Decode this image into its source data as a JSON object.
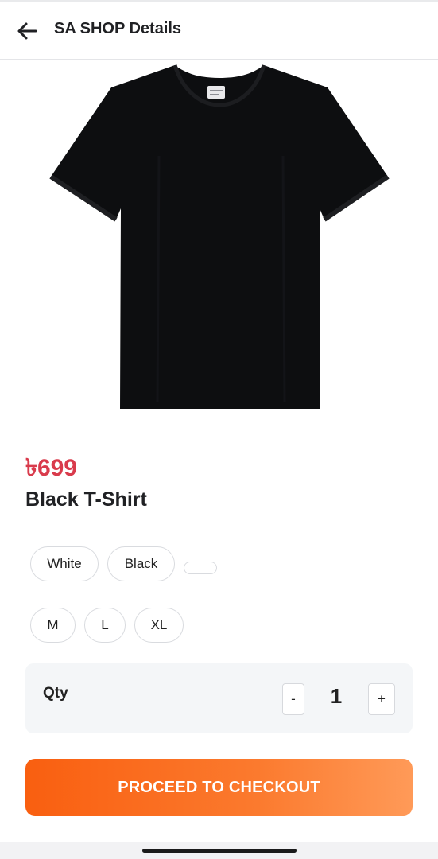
{
  "header": {
    "title": "SA SHOP Details",
    "back_icon": "arrow-left-icon"
  },
  "product": {
    "image_alt": "black-tshirt-image",
    "image_color": "#0d0e10",
    "price": "৳699",
    "name": "Black T-Shirt"
  },
  "colors": {
    "options": [
      "White",
      "Black",
      ""
    ]
  },
  "sizes": {
    "options": [
      "M",
      "L",
      "XL"
    ]
  },
  "quantity": {
    "label": "Qty",
    "decrement_label": "-",
    "value": "1",
    "increment_label": "+"
  },
  "checkout": {
    "label": "PROCEED TO CHECKOUT",
    "accent_color": "#f95f10"
  },
  "theme": {
    "price_color": "#d93b4c"
  }
}
